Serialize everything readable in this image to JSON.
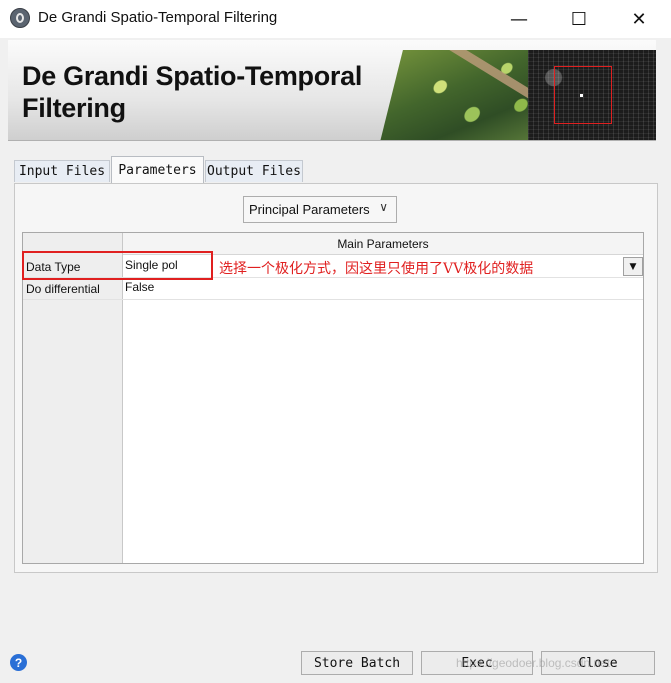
{
  "window": {
    "title": "De Grandi Spatio-Temporal Filtering",
    "minimize_glyph": "—",
    "maximize_glyph": "☐",
    "close_glyph": "✕"
  },
  "banner": {
    "title": "De Grandi Spatio-Temporal Filtering"
  },
  "tabs": [
    {
      "label": "Input Files",
      "active": false
    },
    {
      "label": "Parameters",
      "active": true
    },
    {
      "label": "Output Files",
      "active": false
    }
  ],
  "parameters": {
    "group_select": {
      "value": "Principal Parameters"
    },
    "table": {
      "column_header": "Main Parameters",
      "rows": [
        {
          "label": "Data Type",
          "value": "Single pol"
        },
        {
          "label": "Do differential",
          "value": "False"
        }
      ]
    }
  },
  "annotation": {
    "text": "选择一个极化方式，因这里只使用了VV极化的数据",
    "color": "#e02020"
  },
  "footer": {
    "help_glyph": "?",
    "store_batch_label": "Store Batch",
    "exec_label": "Exec",
    "close_label": "Close"
  },
  "watermark": "https://geodoer.blog.csdn.net"
}
